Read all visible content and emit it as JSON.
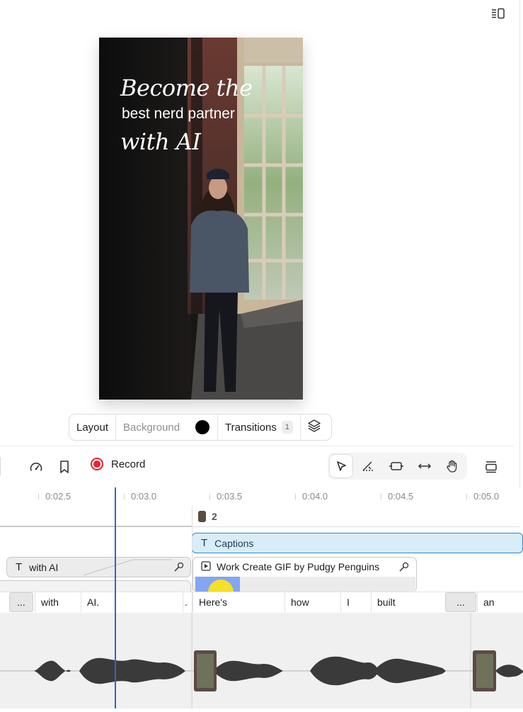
{
  "preview": {
    "caption_line1": "Become the",
    "caption_line2": "best nerd partner",
    "caption_line3": "with AI"
  },
  "property_bar": {
    "layout_label": "Layout",
    "background_label": "Background",
    "background_color": "#000000",
    "transitions_label": "Transitions",
    "transitions_count": "1"
  },
  "toolbar": {
    "record_label": "Record",
    "record_color": "#e8232d"
  },
  "ruler": {
    "ticks": [
      "0:02.5",
      "0:03.0",
      "0:03.5",
      "0:04.0",
      "0:04.5",
      "0:05.0"
    ]
  },
  "timeline": {
    "scene_number": "2",
    "captions_label": "Captions",
    "text_clip_label": "with AI",
    "gif_clip_label": "Work Create GIF by Pudgy Penguins",
    "words": [
      "...",
      "with",
      "AI.",
      ".",
      "Here's",
      "how",
      "I",
      "built",
      "...",
      "an"
    ],
    "playhead_color": "#2f66c9",
    "caption_accent": "#2a8ad2"
  }
}
